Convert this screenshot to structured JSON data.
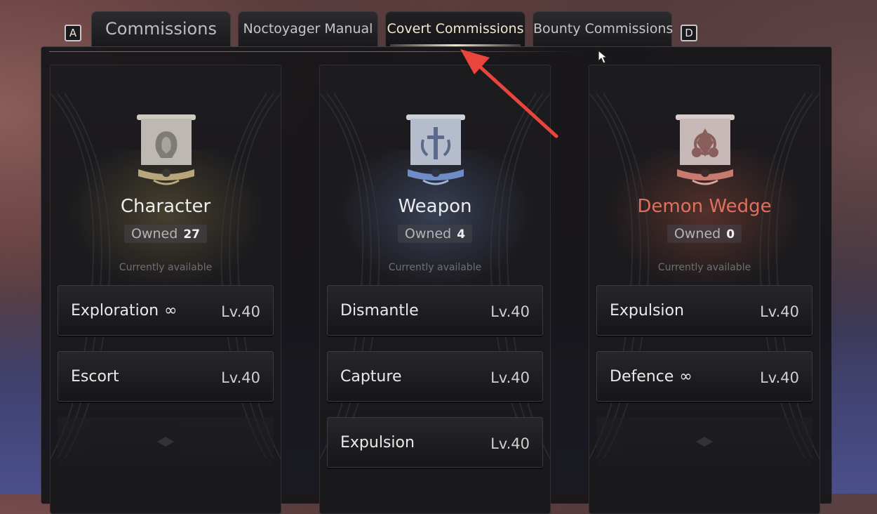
{
  "tabs": {
    "left_key": "A",
    "right_key": "D",
    "items": [
      {
        "label": "Commissions"
      },
      {
        "label": "Noctoyager Manual"
      },
      {
        "label": "Covert Commissions"
      },
      {
        "label": "Bounty Commissions"
      }
    ]
  },
  "cards": [
    {
      "title": "Character",
      "title_color": "#ececec",
      "owned_label": "Owned",
      "owned_count": "27",
      "available_label": "Currently available",
      "missions": [
        {
          "name": "Exploration",
          "infinite": "∞",
          "level": "Lv.40"
        },
        {
          "name": "Escort",
          "infinite": "",
          "level": "Lv.40"
        }
      ]
    },
    {
      "title": "Weapon",
      "title_color": "#ececec",
      "owned_label": "Owned",
      "owned_count": "4",
      "available_label": "Currently available",
      "missions": [
        {
          "name": "Dismantle",
          "infinite": "",
          "level": "Lv.40"
        },
        {
          "name": "Capture",
          "infinite": "",
          "level": "Lv.40"
        },
        {
          "name": "Expulsion",
          "infinite": "",
          "level": "Lv.40"
        }
      ]
    },
    {
      "title": "Demon Wedge",
      "title_color": "#e0705e",
      "owned_label": "Owned",
      "owned_count": "0",
      "available_label": "Currently available",
      "missions": [
        {
          "name": "Expulsion",
          "infinite": "",
          "level": "Lv.40"
        },
        {
          "name": "Defence",
          "infinite": "∞",
          "level": "Lv.40"
        }
      ]
    }
  ],
  "colors": {
    "annotation_arrow": "#e8453c",
    "active_tab_text": "#f1e8cf"
  }
}
